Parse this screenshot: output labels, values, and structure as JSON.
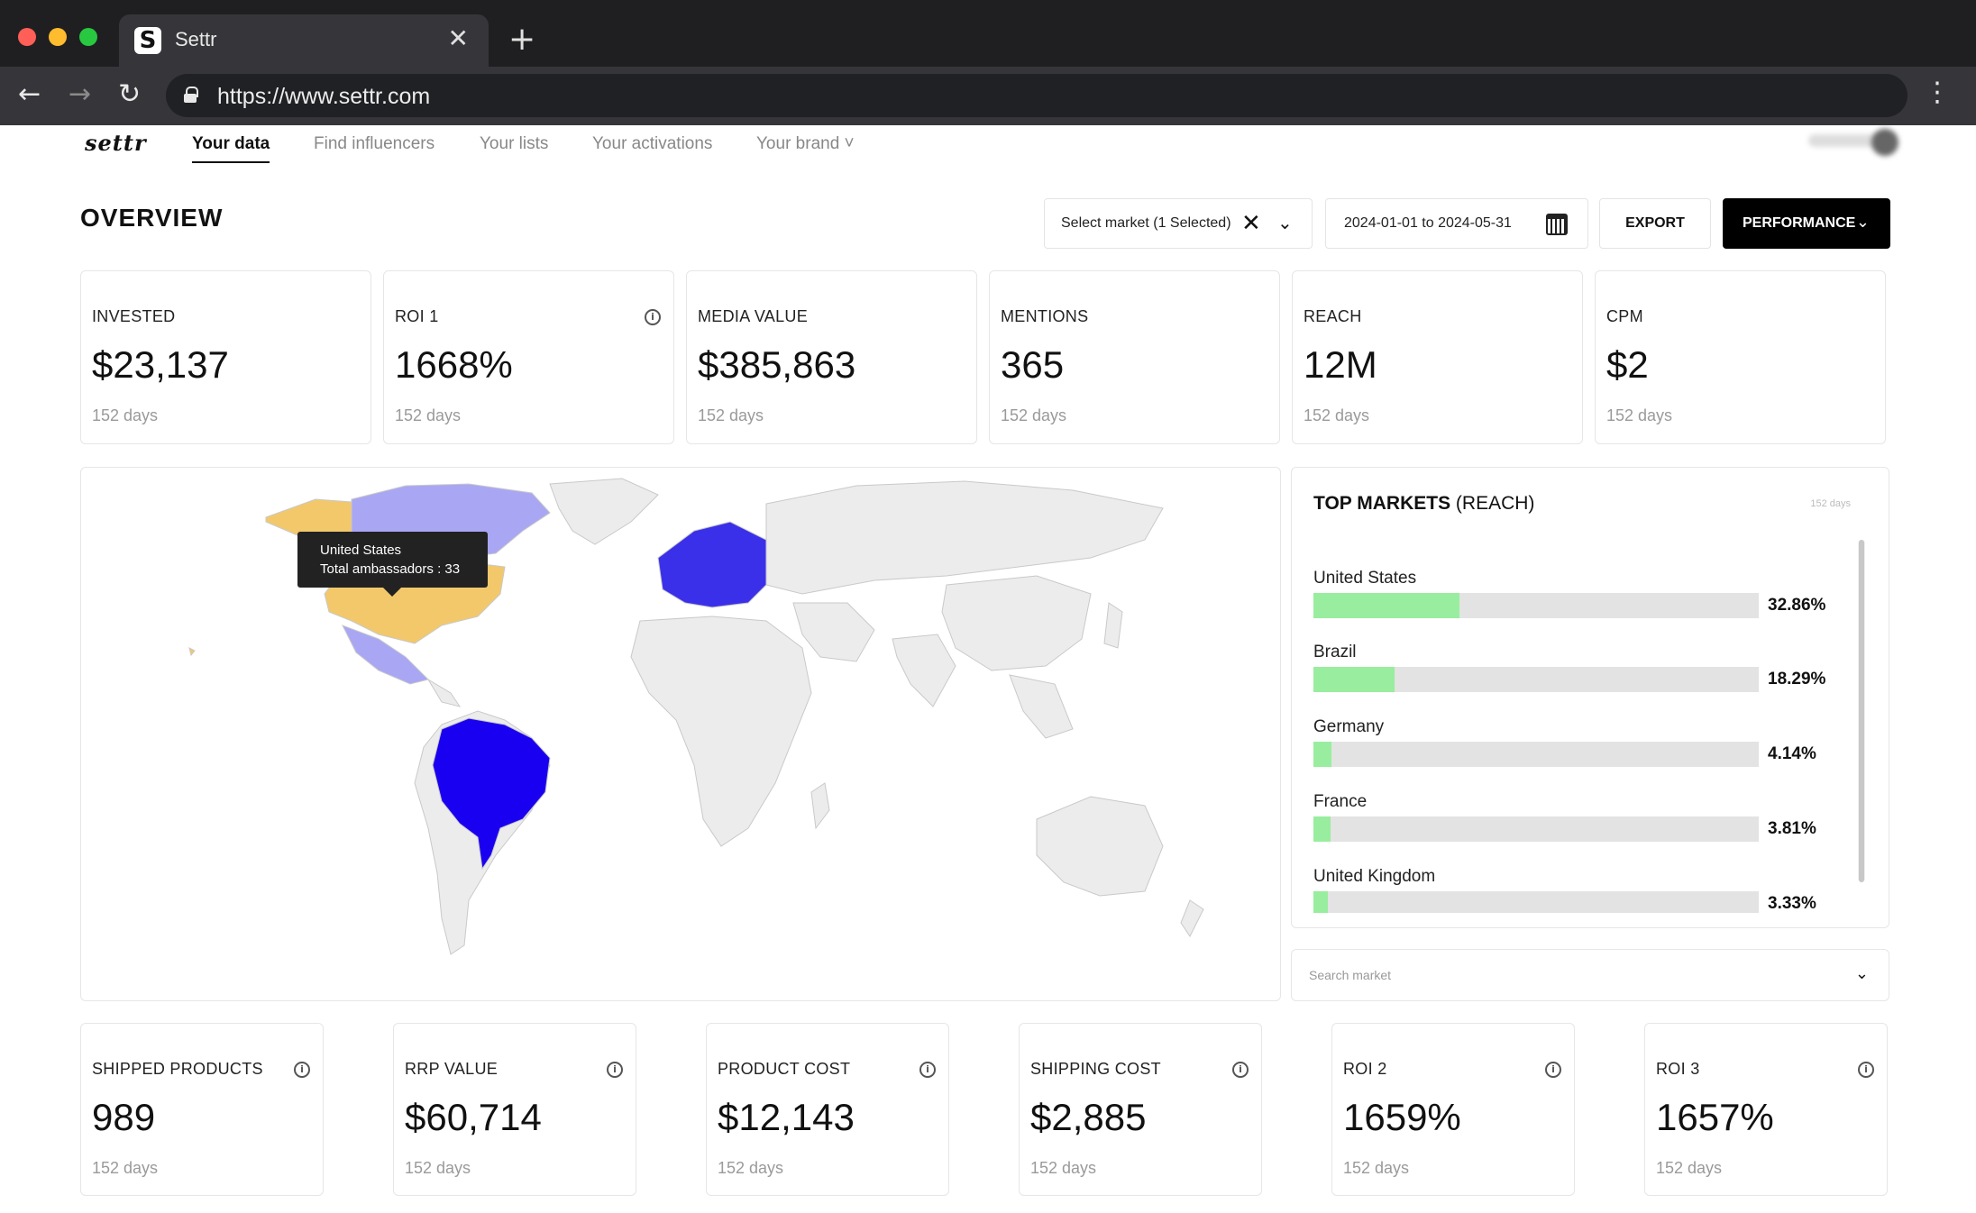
{
  "browser": {
    "tab_title": "Settr",
    "favicon_letter": "S",
    "close_glyph": "✕",
    "new_tab_glyph": "+",
    "url": "https://www.settr.com",
    "back_glyph": "←",
    "forward_glyph": "→",
    "reload_glyph": "↻",
    "menu_glyph": "⋮"
  },
  "nav": {
    "logo": "settr",
    "items": [
      {
        "label": "Your data"
      },
      {
        "label": "Find influencers"
      },
      {
        "label": "Your lists"
      },
      {
        "label": "Your activations"
      },
      {
        "label": "Your brand ˅"
      }
    ]
  },
  "overview": {
    "title": "OVERVIEW",
    "market_select": "Select market (1 Selected)",
    "clear_glyph": "✕",
    "chevron_glyph": "⌄",
    "date_range": "2024-01-01 to 2024-05-31",
    "export_label": "EXPORT",
    "performance_label": "PERFORMANCE"
  },
  "kpis_top": [
    {
      "label": "INVESTED",
      "value": "$23,137",
      "sub": "152 days"
    },
    {
      "label": "ROI 1",
      "value": "1668%",
      "sub": "152 days",
      "info": "i"
    },
    {
      "label": "MEDIA VALUE",
      "value": "$385,863",
      "sub": "152 days"
    },
    {
      "label": "MENTIONS",
      "value": "365",
      "sub": "152 days"
    },
    {
      "label": "REACH",
      "value": "12M",
      "sub": "152 days"
    },
    {
      "label": "CPM",
      "value": "$2",
      "sub": "152 days"
    }
  ],
  "map": {
    "tooltip_country": "United States",
    "tooltip_detail": "Total ambassadors : 33",
    "colors": {
      "land": "#ececec",
      "borders": "#c9c9c9",
      "highlight_gold": "#f2c86b",
      "highlight_lavender": "#a9a6f4",
      "highlight_blue": "#3a30ea",
      "highlight_brazil": "#1a00f0"
    }
  },
  "top_markets": {
    "title_bold": "TOP MARKETS",
    "title_rest": " (REACH)",
    "days": "152 days",
    "bar_color": "#98ee9e",
    "items": [
      {
        "name": "United States",
        "pct_label": "32.86%",
        "pct": 32.86
      },
      {
        "name": "Brazil",
        "pct_label": "18.29%",
        "pct": 18.29
      },
      {
        "name": "Germany",
        "pct_label": "4.14%",
        "pct": 4.14
      },
      {
        "name": "France",
        "pct_label": "3.81%",
        "pct": 3.81
      },
      {
        "name": "United Kingdom",
        "pct_label": "3.33%",
        "pct": 3.33
      }
    ],
    "search_placeholder": "Search market"
  },
  "kpis_bottom": [
    {
      "label": "SHIPPED PRODUCTS",
      "value": "989",
      "sub": "152 days",
      "info": "i"
    },
    {
      "label": "RRP VALUE",
      "value": "$60,714",
      "sub": "152 days",
      "info": "i"
    },
    {
      "label": "PRODUCT COST",
      "value": "$12,143",
      "sub": "152 days",
      "info": "i"
    },
    {
      "label": "SHIPPING COST",
      "value": "$2,885",
      "sub": "152 days",
      "info": "i"
    },
    {
      "label": "ROI 2",
      "value": "1659%",
      "sub": "152 days",
      "info": "i"
    },
    {
      "label": "ROI 3",
      "value": "1657%",
      "sub": "152 days",
      "info": "i"
    }
  ]
}
